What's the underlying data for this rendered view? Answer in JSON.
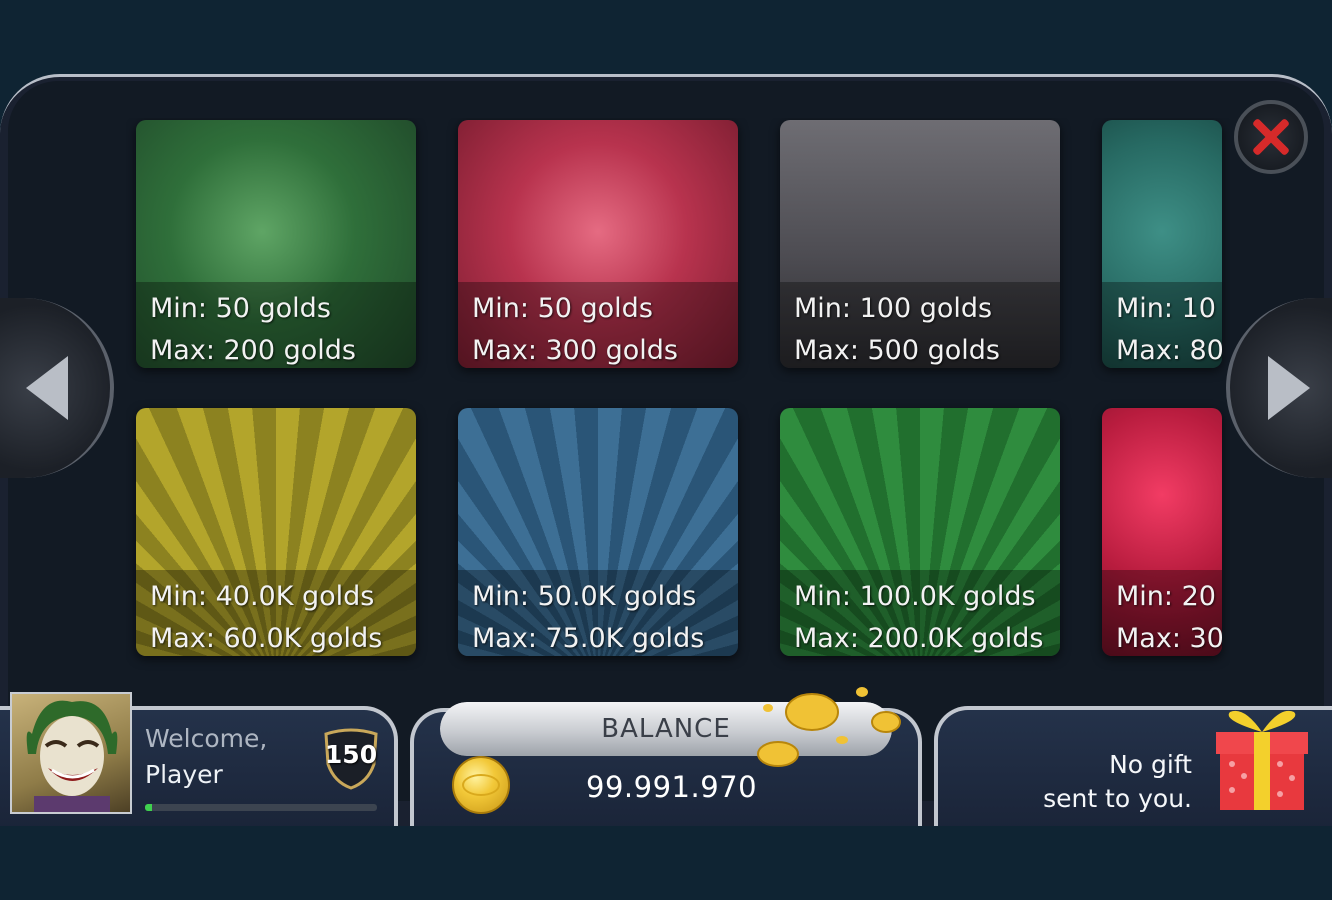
{
  "rooms": [
    {
      "min": "Min: 50 golds",
      "max": "Max: 200 golds",
      "color": "#2f6f3a"
    },
    {
      "min": "Min: 50 golds",
      "max": "Max: 300 golds",
      "color": "#b8334e"
    },
    {
      "min": "Min: 100 golds",
      "max": "Max: 500 golds",
      "color": "#4d4c52"
    },
    {
      "min": "Min: 10",
      "max": "Max: 80",
      "color": "#276a63"
    },
    {
      "min": "Min: 40.0K golds",
      "max": "Max: 60.0K golds",
      "color": "#a09528"
    },
    {
      "min": "Min: 50.0K golds",
      "max": "Max: 75.0K golds",
      "color": "#35648a"
    },
    {
      "min": "Min: 100.0K golds",
      "max": "Max: 200.0K golds",
      "color": "#2a7e37"
    },
    {
      "min": "Min: 20",
      "max": "Max: 30",
      "color": "#c71f44"
    }
  ],
  "nav": {
    "prev_icon": "arrow-left-icon",
    "next_icon": "arrow-right-icon",
    "close_icon": "close-icon"
  },
  "profile": {
    "welcome": "Welcome,",
    "name": "Player",
    "level": "150",
    "xp_progress_percent": 3
  },
  "balance": {
    "label": "BALANCE",
    "value": "99.991.970",
    "coin_icon": "gold-coin-icon"
  },
  "gift": {
    "line1": "No gift",
    "line2": "sent to you.",
    "icon": "gift-box-icon"
  }
}
